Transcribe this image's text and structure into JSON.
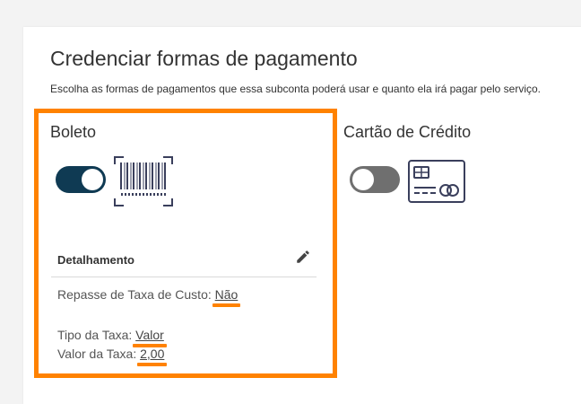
{
  "header": {
    "title": "Credenciar formas de pagamento",
    "subtitle": "Escolha as formas de pagamentos que essa subconta poderá usar e quanto ela irá pagar pelo serviço."
  },
  "methods": [
    {
      "name": "Boleto",
      "enabled": true,
      "icon": "barcode-icon",
      "details": {
        "title": "Detalhamento",
        "edit_icon": "pencil-icon",
        "fee_pass_label": "Repasse de Taxa de Custo:",
        "fee_pass_value": "Não",
        "fee_type_label": "Tipo da Taxa:",
        "fee_type_value": "Valor",
        "fee_value_label": "Valor da Taxa:",
        "fee_value_value": "2,00"
      }
    },
    {
      "name": "Cartão de Crédito",
      "enabled": false,
      "icon": "credit-card-icon"
    }
  ],
  "colors": {
    "accent_highlight": "#ff8200",
    "toggle_on": "#0f3a53",
    "toggle_off": "#6f6f6f",
    "icon_stroke": "#3a3f5c"
  }
}
